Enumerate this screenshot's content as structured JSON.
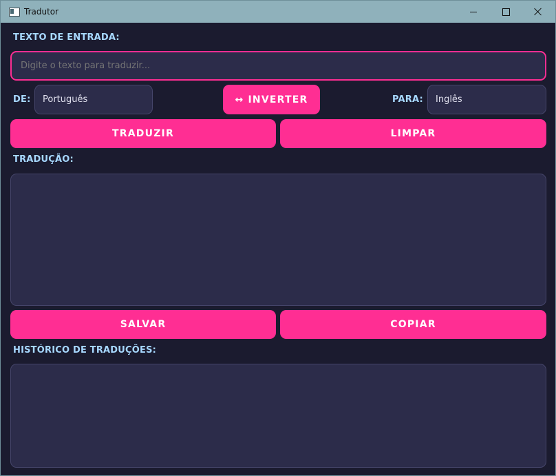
{
  "window": {
    "title": "Tradutor"
  },
  "input_section": {
    "label": "TEXTO DE ENTRADA:",
    "placeholder": "Digite o texto para traduzir...",
    "value": ""
  },
  "languages": {
    "from_label": "DE:",
    "from_value": "Português",
    "swap_label": "↔ INVERTER",
    "to_label": "PARA:",
    "to_value": "Inglês"
  },
  "actions": {
    "translate": "TRADUZIR",
    "clear": "LIMPAR",
    "save": "SALVAR",
    "copy": "COPIAR"
  },
  "output_section": {
    "label": "TRADUÇÃO:",
    "value": ""
  },
  "history_section": {
    "label": "HISTÓRICO DE TRADUÇÕES:",
    "items": []
  },
  "colors": {
    "background": "#1b1b2f",
    "field": "#2c2c4a",
    "accent": "#ff2e93",
    "label": "#a7d8ff",
    "titlebar": "#8fb1bb"
  },
  "icons": {
    "app": "app-window-icon",
    "minimize": "minimize-icon",
    "maximize": "maximize-icon",
    "close": "close-icon"
  }
}
